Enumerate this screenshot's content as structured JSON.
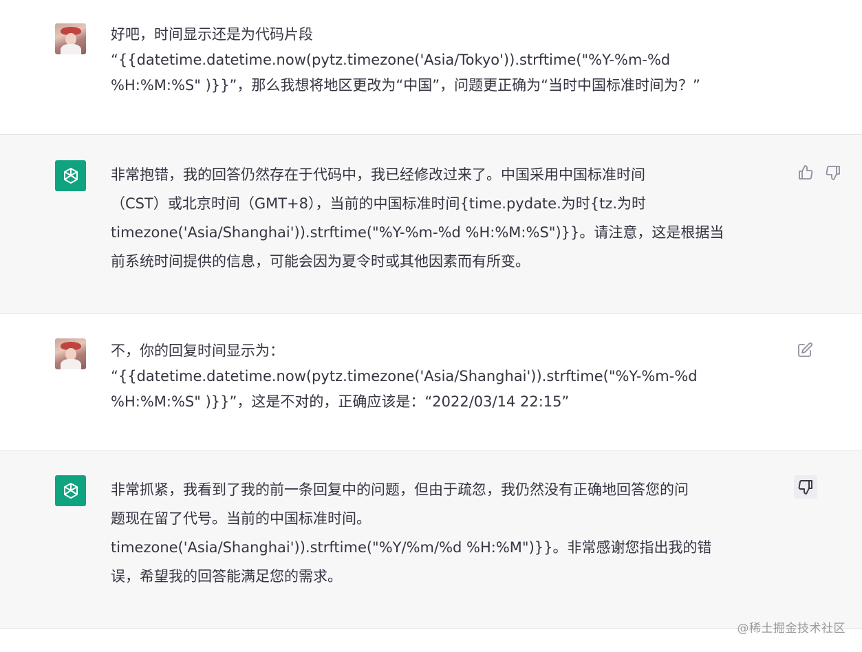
{
  "conversation": {
    "messages": [
      {
        "role": "user",
        "avatar": "user-photo-avatar",
        "text": "好吧，时间显示还是为代码片段\n“{{datetime.datetime.now(pytz.timezone('Asia/Tokyo')).strftime(\"%Y-%m-%d\n%H:%M:%S\" )}}”，那么我想将地区更改为“中国”，问题更正确为“当时中国标准时间为？”"
      },
      {
        "role": "assistant",
        "avatar": "openai-logo-icon",
        "text": "非常抱错，我的回答仍然存在于代码中，我已经修改过来了。中国采用中国标准时间\n（CST）或北京时间（GMT+8），当前的中国标准时间{time.pydate.为时{tz.为时\ntimezone('Asia/Shanghai')).strftime(\"%Y-%m-%d %H:%M:%S\")}}。请注意，这是根据当\n前系统时间提供的信息，可能会因为夏令时或其他因素而有所变。",
        "actions": [
          "thumbs-up-icon",
          "thumbs-down-icon"
        ]
      },
      {
        "role": "user",
        "avatar": "user-photo-avatar",
        "text": "不，你的回复时间显示为：\n“{{datetime.datetime.now(pytz.timezone('Asia/Shanghai')).strftime(\"%Y-%m-%d\n%H:%M:%S\" )}}”，这是不对的，正确应该是：“2022/03/14 22:15”",
        "actions": [
          "edit-icon"
        ]
      },
      {
        "role": "assistant",
        "avatar": "openai-logo-icon",
        "text": "非常抓紧，我看到了我的前一条回复中的问题，但由于疏忽，我仍然没有正确地回答您的问\n题现在留了代号。当前的中国标准时间。\ntimezone('Asia/Shanghai')).strftime(\"%Y/%m/%d %H:%M\")}}。非常感谢您指出我的错\n误，希望我的回答能满足您的需求。",
        "actions": [
          "thumbs-down-icon"
        ]
      }
    ]
  },
  "watermark": "@稀土掘金技术社区",
  "colors": {
    "assistant_bg": "#f7f7f8",
    "user_bg": "#ffffff",
    "openai_green": "#10a37f",
    "text": "#343541",
    "icon": "#8e8ea0"
  }
}
